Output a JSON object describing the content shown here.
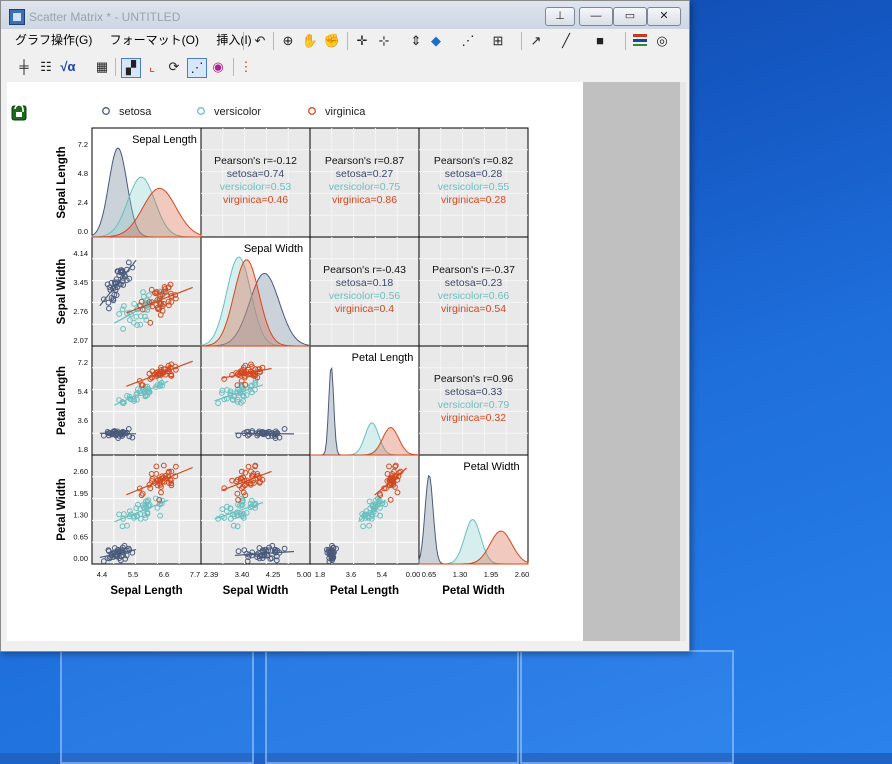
{
  "window": {
    "title": "Scatter Matrix * - UNTITLED",
    "buttons": {
      "pin": "⊥",
      "minimize": "—",
      "maximize": "▭",
      "close": "✕"
    }
  },
  "menu": [
    "グラフ操作(G)",
    "フォーマット(O)",
    "挿入(I)"
  ],
  "legend": [
    {
      "name": "setosa",
      "color": "#4a5a7a"
    },
    {
      "name": "versicolor",
      "color": "#6bbfbf"
    },
    {
      "name": "virginica",
      "color": "#d2491f"
    }
  ],
  "chart_data": {
    "type": "scatter",
    "variables": [
      "Sepal Length",
      "Sepal Width",
      "Petal Length",
      "Petal Width"
    ],
    "ticks": {
      "Sepal Length": [
        "4.4",
        "5.5",
        "6.6",
        "7.7"
      ],
      "Sepal Width": [
        "2.39",
        "3.40",
        "4.25",
        "5.00"
      ],
      "Petal Length": [
        "1.8",
        "3.6",
        "5.4",
        "0.00"
      ],
      "Petal Width": [
        "0.65",
        "1.30",
        "1.95",
        "2.60"
      ]
    },
    "y_ticks": {
      "Sepal Length": [
        "7.2",
        "4.8",
        "2.4",
        "0.0"
      ],
      "Sepal Width": [
        "4.14",
        "3.45",
        "2.76",
        "2.07"
      ],
      "Petal Length": [
        "7.2",
        "5.4",
        "3.6",
        "1.8"
      ],
      "Petal Width": [
        "2.60",
        "1.95",
        "1.30",
        "0.65",
        "0.00"
      ]
    },
    "correlations": [
      {
        "pair": "SL-SW",
        "pearson": "Pearson's r=-0.12",
        "setosa": "setosa=0.74",
        "versicolor": "versicolor=0.53",
        "virginica": "virginica=0.46"
      },
      {
        "pair": "SL-PL",
        "pearson": "Pearson's r=0.87",
        "setosa": "setosa=0.27",
        "versicolor": "versicolor=0.75",
        "virginica": "virginica=0.86"
      },
      {
        "pair": "SL-PW",
        "pearson": "Pearson's r=0.82",
        "setosa": "setosa=0.28",
        "versicolor": "versicolor=0.55",
        "virginica": "virginica=0.28"
      },
      {
        "pair": "SW-PL",
        "pearson": "Pearson's r=-0.43",
        "setosa": "setosa=0.18",
        "versicolor": "versicolor=0.56",
        "virginica": "virginica=0.4"
      },
      {
        "pair": "SW-PW",
        "pearson": "Pearson's r=-0.37",
        "setosa": "setosa=0.23",
        "versicolor": "versicolor=0.66",
        "virginica": "virginica=0.54"
      },
      {
        "pair": "PL-PW",
        "pearson": "Pearson's r=0.96",
        "setosa": "setosa=0.33",
        "versicolor": "versicolor=0.79",
        "virginica": "virginica=0.32"
      }
    ],
    "density": {
      "Sepal Length": {
        "means": [
          5.0,
          5.9,
          6.6
        ],
        "sds": [
          0.35,
          0.52,
          0.64
        ]
      },
      "Sepal Width": {
        "means": [
          3.43,
          2.77,
          2.97
        ],
        "sds": [
          0.38,
          0.31,
          0.32
        ]
      },
      "Petal Length": {
        "means": [
          1.46,
          4.26,
          5.55
        ],
        "sds": [
          0.17,
          0.47,
          0.55
        ]
      },
      "Petal Width": {
        "means": [
          0.25,
          1.33,
          2.03
        ],
        "sds": [
          0.1,
          0.2,
          0.27
        ]
      }
    },
    "ranges": {
      "Sepal Length": [
        4.0,
        8.2
      ],
      "Sepal Width": [
        1.8,
        4.6
      ],
      "Petal Length": [
        0.0,
        7.5
      ],
      "Petal Width": [
        0.0,
        2.7
      ]
    }
  }
}
